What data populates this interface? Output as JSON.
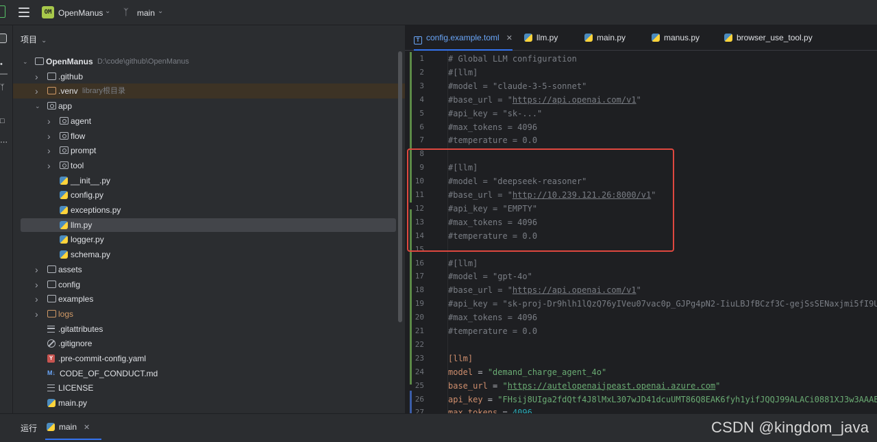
{
  "titlebar": {
    "project_badge": "OM",
    "project_name": "OpenManus",
    "branch": "main"
  },
  "project_panel": {
    "title": "项目",
    "tree": [
      {
        "name": "OpenManus",
        "hint": "D:\\code\\github\\OpenManus",
        "type": "folder",
        "depth": 0,
        "expanded": true,
        "bold": true
      },
      {
        "name": ".github",
        "type": "folder",
        "depth": 1
      },
      {
        "name": ".venv",
        "hint": "library根目录",
        "type": "folder-orange",
        "depth": 1,
        "venv": true
      },
      {
        "name": "app",
        "type": "folder-pkg",
        "depth": 1,
        "expanded": true
      },
      {
        "name": "agent",
        "type": "folder-pkg",
        "depth": 2
      },
      {
        "name": "flow",
        "type": "folder-pkg",
        "depth": 2
      },
      {
        "name": "prompt",
        "type": "folder-pkg",
        "depth": 2
      },
      {
        "name": "tool",
        "type": "folder-pkg",
        "depth": 2
      },
      {
        "name": "__init__.py",
        "type": "py",
        "depth": 2
      },
      {
        "name": "config.py",
        "type": "py",
        "depth": 2
      },
      {
        "name": "exceptions.py",
        "type": "py",
        "depth": 2
      },
      {
        "name": "llm.py",
        "type": "py",
        "depth": 2,
        "selected": true
      },
      {
        "name": "logger.py",
        "type": "py",
        "depth": 2
      },
      {
        "name": "schema.py",
        "type": "py",
        "depth": 2
      },
      {
        "name": "assets",
        "type": "folder",
        "depth": 1
      },
      {
        "name": "config",
        "type": "folder",
        "depth": 1
      },
      {
        "name": "examples",
        "type": "folder",
        "depth": 1
      },
      {
        "name": "logs",
        "type": "folder-orange",
        "depth": 1,
        "orange": true
      },
      {
        "name": ".gitattributes",
        "type": "lines",
        "depth": 1
      },
      {
        "name": ".gitignore",
        "type": "ban",
        "depth": 1
      },
      {
        "name": ".pre-commit-config.yaml",
        "type": "yaml",
        "depth": 1
      },
      {
        "name": "CODE_OF_CONDUCT.md",
        "type": "md",
        "depth": 1
      },
      {
        "name": "LICENSE",
        "type": "lines",
        "depth": 1
      },
      {
        "name": "main.py",
        "type": "py",
        "depth": 1
      }
    ]
  },
  "editor": {
    "tabs": [
      {
        "label": "config.example.toml",
        "icon": "toml",
        "active": true
      },
      {
        "label": "llm.py",
        "icon": "py"
      },
      {
        "label": "main.py",
        "icon": "py"
      },
      {
        "label": "manus.py",
        "icon": "py"
      },
      {
        "label": "browser_use_tool.py",
        "icon": "py"
      }
    ],
    "lines": [
      {
        "n": "1",
        "text": "# Global LLM configuration"
      },
      {
        "n": "2",
        "text": "#[llm]"
      },
      {
        "n": "3",
        "text": "#model = \"claude-3-5-sonnet\""
      },
      {
        "n": "4",
        "pre": "#base_url = \"",
        "url": "https://api.openai.com/v1",
        "post": "\""
      },
      {
        "n": "5",
        "text": "#api_key = \"sk-...\""
      },
      {
        "n": "6",
        "text": "#max_tokens = 4096"
      },
      {
        "n": "7",
        "text": "#temperature = 0.0"
      },
      {
        "n": "8",
        "text": ""
      },
      {
        "n": "9",
        "text": "#[llm]"
      },
      {
        "n": "10",
        "text": "#model = \"deepseek-reasoner\""
      },
      {
        "n": "11",
        "pre": "#base_url = \"",
        "url": "http://10.239.121.26:8000/v1",
        "post": "\""
      },
      {
        "n": "12",
        "text": "#api_key = \"EMPTY\""
      },
      {
        "n": "13",
        "text": "#max_tokens = 4096"
      },
      {
        "n": "14",
        "text": "#temperature = 0.0"
      },
      {
        "n": "15",
        "text": ""
      },
      {
        "n": "16",
        "text": "#[llm]"
      },
      {
        "n": "17",
        "text": "#model = \"gpt-4o\""
      },
      {
        "n": "18",
        "pre": "#base_url = \"",
        "url": "https://api.openai.com/v1",
        "post": "\""
      },
      {
        "n": "19",
        "text": "#api_key = \"sk-proj-Dr9hlh1lQzQ76yIVeu07vac0p_GJPg4pN2-IiuLBJfBCzf3C-gejSsSENaxjmi5fI9U"
      },
      {
        "n": "20",
        "text": "#max_tokens = 4096"
      },
      {
        "n": "21",
        "text": "#temperature = 0.0"
      },
      {
        "n": "22",
        "text": ""
      },
      {
        "n": "23",
        "section": "[llm]"
      },
      {
        "n": "24",
        "key": "model",
        "eq": " = ",
        "str": "\"demand_charge_agent_4o\""
      },
      {
        "n": "25",
        "key": "base_url",
        "eq": " = ",
        "q1": "\"",
        "surl": "https://autelopenaijpeast.openai.azure.com",
        "q2": "\""
      },
      {
        "n": "26",
        "key": "api_key",
        "eq": " = ",
        "str": "\"FHsij8UIga2fdQtf4J8lMxL307wJD41dcuUMT86Q8EAK6fyh1yifJQQJ99ALACi0881XJ3w3AAAB"
      },
      {
        "n": "27",
        "key": "max_tokens",
        "eq": " = ",
        "num": "4096"
      }
    ]
  },
  "bottom": {
    "run_label": "运行",
    "run_tab": "main"
  },
  "watermark": "CSDN @kingdom_java"
}
